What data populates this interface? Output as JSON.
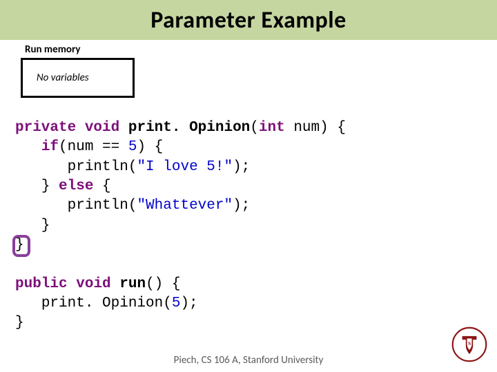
{
  "title": "Parameter Example",
  "section_label": "Run memory",
  "memory_box_text": "No variables",
  "code": {
    "l1_kw1": "private",
    "l1_kw2": "void",
    "l1_name": "print. Opinion",
    "l1_param_type": "int",
    "l1_param_name": " num) {",
    "l2_indent": "   ",
    "l2_kw": "if",
    "l2_rest": "(num == ",
    "l2_num": "5",
    "l2_end": ") {",
    "l3_indent": "      ",
    "l3_call": "println(",
    "l3_str": "\"I love 5!\"",
    "l3_end": ");",
    "l4_indent": "   ",
    "l4_brace": "} ",
    "l4_kw": "else",
    "l4_end": " {",
    "l5_indent": "      ",
    "l5_call": "println(",
    "l5_str": "\"Whattever\"",
    "l5_end": ");",
    "l6": "   }",
    "l7": "}",
    "blank": "",
    "l8_kw1": "public",
    "l8_kw2": "void",
    "l8_name": "run",
    "l8_end": "() {",
    "l9_indent": "   ",
    "l9_call": "print. Opinion(",
    "l9_num": "5",
    "l9_end": ");",
    "l10": "}"
  },
  "footer": "Piech, CS 106 A, Stanford University"
}
